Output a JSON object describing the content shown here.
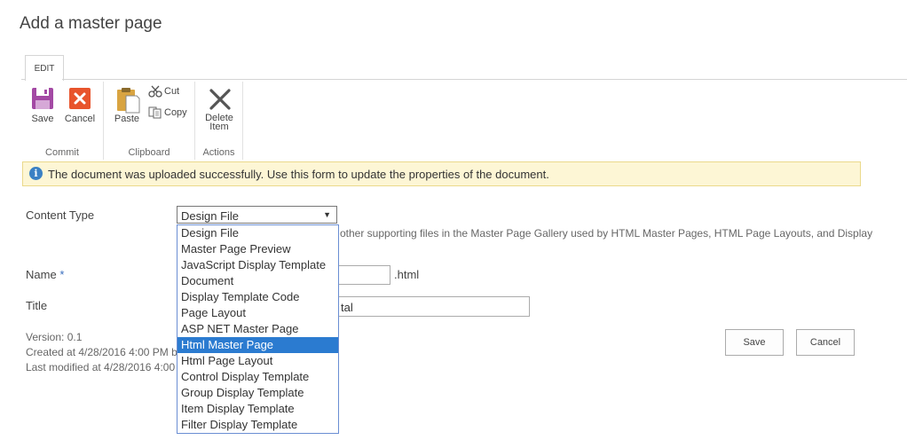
{
  "page": {
    "title": "Add a master page"
  },
  "ribbon": {
    "tab": "EDIT",
    "groups": {
      "commit": {
        "label": "Commit",
        "save": "Save",
        "cancel": "Cancel"
      },
      "clipboard": {
        "label": "Clipboard",
        "paste": "Paste",
        "cut": "Cut",
        "copy": "Copy"
      },
      "actions": {
        "label": "Actions",
        "delete_line1": "Delete",
        "delete_line2": "Item"
      }
    }
  },
  "message": {
    "icon": "info-icon",
    "text": "The document was uploaded successfully. Use this form to update the properties of the document."
  },
  "form": {
    "content_type": {
      "label": "Content Type",
      "selected": "Design File",
      "description_visible": "other supporting files in the Master Page Gallery used by HTML Master Pages, HTML Page Layouts, and Display"
    },
    "name": {
      "label": "Name",
      "required_marker": "*",
      "extension": ".html"
    },
    "title": {
      "label": "Title",
      "visible_value": "tal"
    },
    "meta": {
      "version": "Version: 0.1",
      "created_visible": "Created at 4/28/2016 4:00 PM  by",
      "modified_visible": "Last modified at 4/28/2016 4:00 P"
    },
    "buttons": {
      "save": "Save",
      "cancel": "Cancel"
    }
  },
  "dropdown": {
    "options": [
      "Design File",
      "Master Page Preview",
      "JavaScript Display Template",
      "Document",
      "Display Template Code",
      "Page Layout",
      "ASP NET Master Page",
      "Html Master Page",
      "Html Page Layout",
      "Control Display Template",
      "Group Display Template",
      "Item Display Template",
      "Filter Display Template"
    ],
    "highlighted": "Html Master Page"
  },
  "colors": {
    "highlight": "#2b7bd0",
    "message_bg": "#fdf6d5",
    "save_icon": "#a349a4",
    "cancel_icon": "#e8542c"
  }
}
